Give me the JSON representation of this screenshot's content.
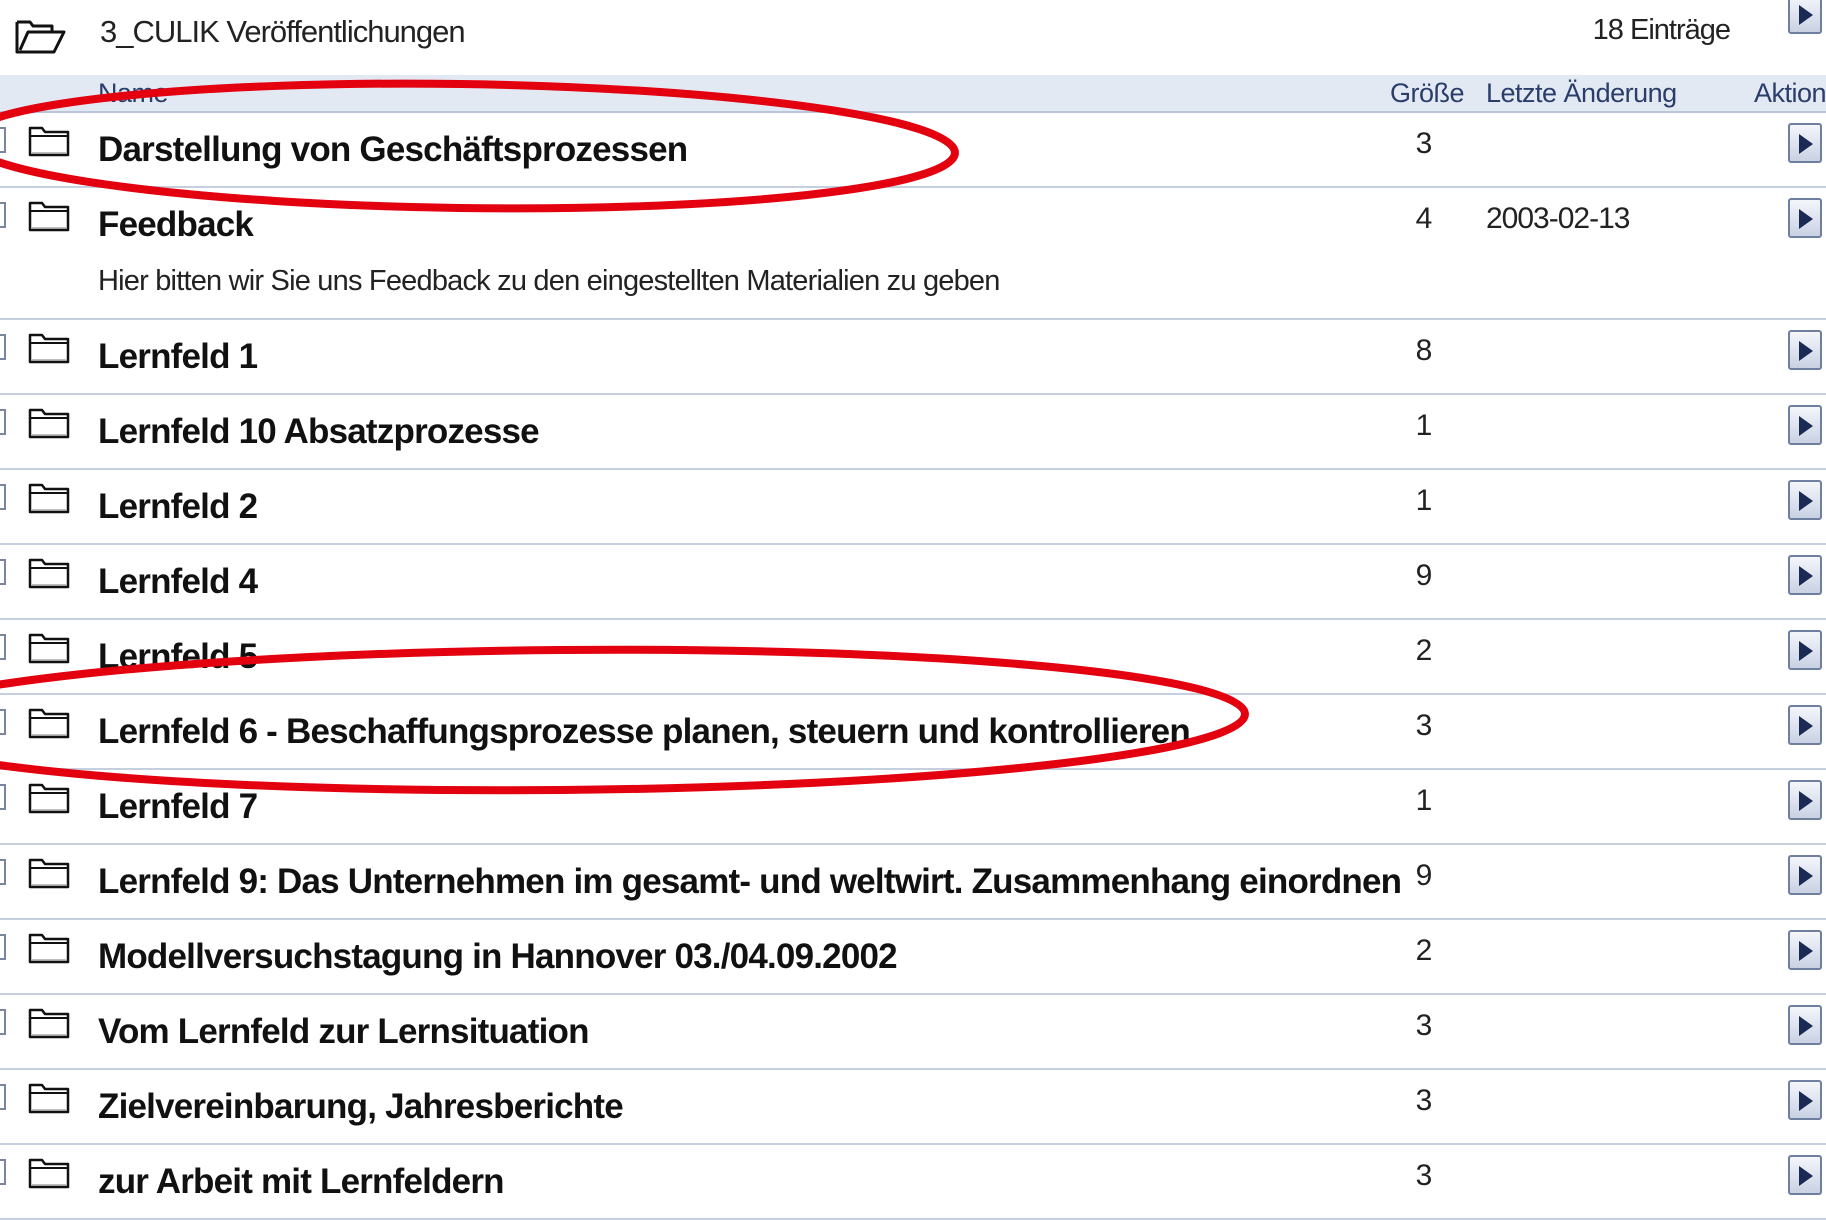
{
  "header": {
    "title": "3_CULIK Veröffentlichungen",
    "count": "18 Einträge"
  },
  "columns": {
    "name": "Name",
    "size": "Größe",
    "modified": "Letzte Änderung",
    "action": "Aktion"
  },
  "rows": [
    {
      "name": "Darstellung von Geschäftsprozessen",
      "size": "3",
      "date": "",
      "description": ""
    },
    {
      "name": "Feedback",
      "size": "4",
      "date": "2003-02-13",
      "description": "Hier bitten wir Sie uns Feedback zu den eingestellten Materialien zu geben"
    },
    {
      "name": "Lernfeld 1",
      "size": "8",
      "date": "",
      "description": ""
    },
    {
      "name": "Lernfeld 10 Absatzprozesse",
      "size": "1",
      "date": "",
      "description": ""
    },
    {
      "name": "Lernfeld 2",
      "size": "1",
      "date": "",
      "description": ""
    },
    {
      "name": "Lernfeld 4",
      "size": "9",
      "date": "",
      "description": ""
    },
    {
      "name": "Lernfeld 5",
      "size": "2",
      "date": "",
      "description": ""
    },
    {
      "name": "Lernfeld 6 - Beschaffungsprozesse planen, steuern und kontrollieren",
      "size": "3",
      "date": "",
      "description": ""
    },
    {
      "name": "Lernfeld 7",
      "size": "1",
      "date": "",
      "description": ""
    },
    {
      "name": "Lernfeld 9: Das Unternehmen im gesamt- und weltwirt. Zusammenhang einordnen",
      "size": "9",
      "date": "",
      "description": ""
    },
    {
      "name": "Modellversuchstagung in Hannover 03./04.09.2002",
      "size": "2",
      "date": "",
      "description": ""
    },
    {
      "name": "Vom Lernfeld zur Lernsituation",
      "size": "3",
      "date": "",
      "description": ""
    },
    {
      "name": "Zielvereinbarung, Jahresberichte",
      "size": "3",
      "date": "",
      "description": ""
    },
    {
      "name": "zur Arbeit mit Lernfeldern",
      "size": "3",
      "date": "",
      "description": ""
    }
  ],
  "annotation_color": "#e3000f"
}
